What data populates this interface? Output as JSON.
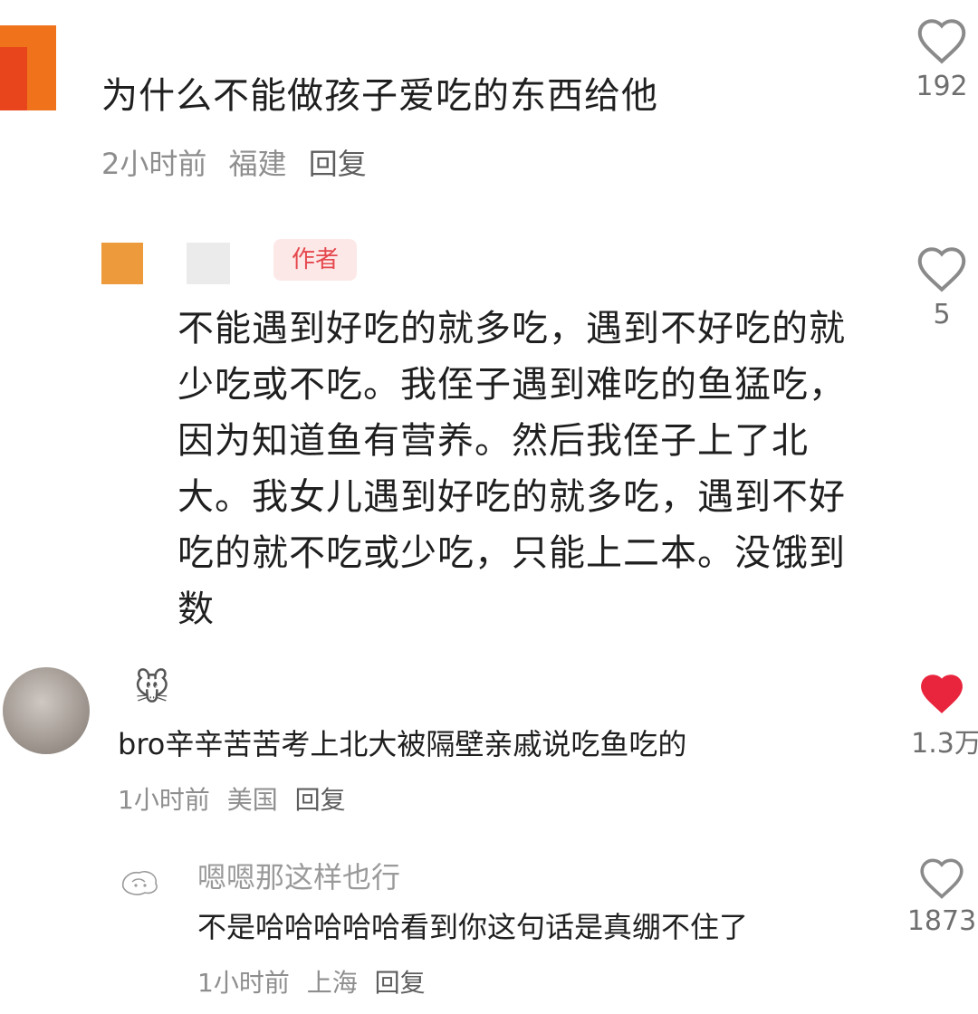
{
  "comments": [
    {
      "text": "为什么不能做孩子爱吃的东西给他",
      "time": "2小时前",
      "location": "福建",
      "reply_label": "回复",
      "likes": "192",
      "liked": false
    },
    {
      "author_badge": "作者",
      "text": "不能遇到好吃的就多吃，遇到不好吃的就少吃或不吃。我侄子遇到难吃的鱼猛吃，因为知道鱼有营养。然后我侄子上了北大。我女儿遇到好吃的就多吃，遇到不好吃的就不吃或少吃，只能上二本。没饿到数",
      "likes": "5",
      "liked": false
    },
    {
      "username_icon": "🐭",
      "text": "bro辛辛苦苦考上北大被隔壁亲戚说吃鱼吃的",
      "time": "1小时前",
      "location": "美国",
      "reply_label": "回复",
      "likes": "1.3万",
      "liked": true
    },
    {
      "username": "嗯嗯那这样也行",
      "text": "不是哈哈哈哈哈看到你这句话是真绷不住了",
      "time": "1小时前",
      "location": "上海",
      "reply_label": "回复",
      "likes": "1873",
      "liked": false
    }
  ],
  "colors": {
    "like_active": "#e8253d",
    "meta_text": "#8e8e8e",
    "author_badge_bg": "#fde8e8",
    "author_badge_text": "#e5484d"
  },
  "icons": {
    "like": "heart-icon",
    "avatar_placeholder": "avatar-icon"
  }
}
